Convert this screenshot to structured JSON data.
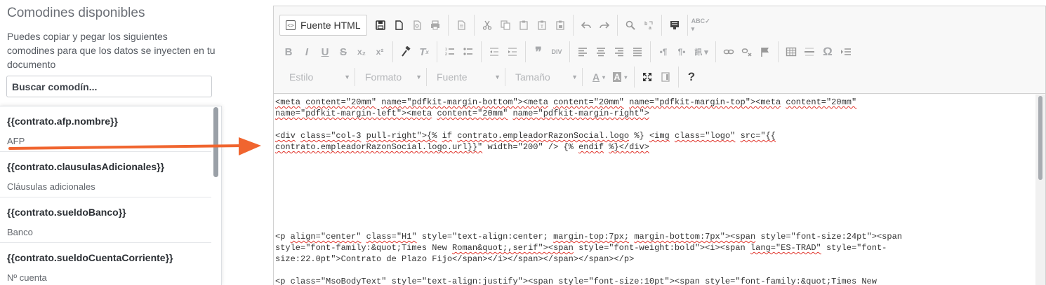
{
  "sidebar": {
    "title": "Comodines disponibles",
    "description": "Puedes copiar y pegar los siguientes comodines para que los datos se inyecten en tu documento",
    "search_placeholder": "Buscar comodín...",
    "items": [
      {
        "code": "{{contrato.afp.nombre}}",
        "label": "AFP"
      },
      {
        "code": "{{contrato.clausulasAdicionales}}",
        "label": "Cláusulas adicionales"
      },
      {
        "code": "{{contrato.sueldoBanco}}",
        "label": "Banco"
      },
      {
        "code": "{{contrato.sueldoCuentaCorriente}}",
        "label": "Nº cuenta"
      }
    ]
  },
  "toolbar": {
    "source_label": "Fuente HTML",
    "combos": {
      "style": "Estilo",
      "format": "Formato",
      "font": "Fuente",
      "size": "Tamaño"
    },
    "help": "?"
  },
  "colors": {
    "arrow": "#f0652f",
    "spell_error": "#e0342b"
  },
  "code_lines": [
    "<meta content=\"20mm\" name=\"pdfkit-margin-bottom\"><meta content=\"20mm\" name=\"pdfkit-margin-top\"><meta content=\"20mm\"",
    "name=\"pdfkit-margin-left\"><meta content=\"20mm\" name=\"pdfkit-margin-right\">",
    "",
    "<div class=\"col-3 pull-right\">{% if contrato.empleadorRazonSocial.logo %} <img class=\"logo\" src=\"{{",
    "contrato.empleadorRazonSocial.logo.url}}\" width=\"200\" /> {% endif %}</div>",
    "",
    "",
    "",
    "",
    "",
    "",
    "",
    "<p align=\"center\" class=\"H1\" style=\"text-align:center; margin-top:7px; margin-bottom:7px\"><span style=\"font-size:24pt\"><span",
    "style=\"font-family:&quot;Times New Roman&quot;,serif\"><span style=\"font-weight:bold\"><i><span lang=\"ES-TRAD\" style=\"font-",
    "size:22.0pt\">Contrato de Plazo Fijo</span></i></span></span></span></p>",
    "",
    "<p class=\"MsoBodyText\" style=\"text-align:justify\"><span style=\"font-size:10pt\"><span style=\"font-family:&quot;Times New"
  ]
}
